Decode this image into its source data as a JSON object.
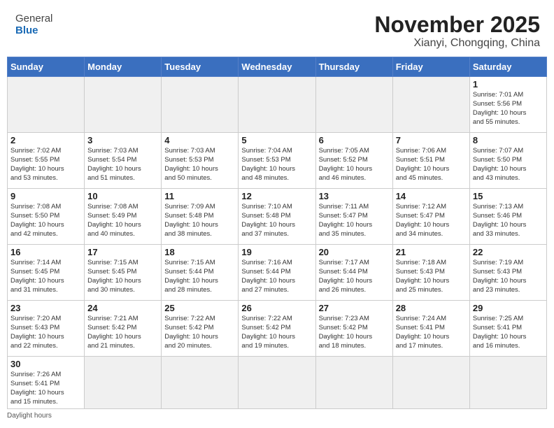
{
  "header": {
    "logo_general": "General",
    "logo_blue": "Blue",
    "month": "November 2025",
    "location": "Xianyi, Chongqing, China"
  },
  "weekdays": [
    "Sunday",
    "Monday",
    "Tuesday",
    "Wednesday",
    "Thursday",
    "Friday",
    "Saturday"
  ],
  "weeks": [
    [
      {
        "day": "",
        "info": ""
      },
      {
        "day": "",
        "info": ""
      },
      {
        "day": "",
        "info": ""
      },
      {
        "day": "",
        "info": ""
      },
      {
        "day": "",
        "info": ""
      },
      {
        "day": "",
        "info": ""
      },
      {
        "day": "1",
        "info": "Sunrise: 7:01 AM\nSunset: 5:56 PM\nDaylight: 10 hours\nand 55 minutes."
      }
    ],
    [
      {
        "day": "2",
        "info": "Sunrise: 7:02 AM\nSunset: 5:55 PM\nDaylight: 10 hours\nand 53 minutes."
      },
      {
        "day": "3",
        "info": "Sunrise: 7:03 AM\nSunset: 5:54 PM\nDaylight: 10 hours\nand 51 minutes."
      },
      {
        "day": "4",
        "info": "Sunrise: 7:03 AM\nSunset: 5:53 PM\nDaylight: 10 hours\nand 50 minutes."
      },
      {
        "day": "5",
        "info": "Sunrise: 7:04 AM\nSunset: 5:53 PM\nDaylight: 10 hours\nand 48 minutes."
      },
      {
        "day": "6",
        "info": "Sunrise: 7:05 AM\nSunset: 5:52 PM\nDaylight: 10 hours\nand 46 minutes."
      },
      {
        "day": "7",
        "info": "Sunrise: 7:06 AM\nSunset: 5:51 PM\nDaylight: 10 hours\nand 45 minutes."
      },
      {
        "day": "8",
        "info": "Sunrise: 7:07 AM\nSunset: 5:50 PM\nDaylight: 10 hours\nand 43 minutes."
      }
    ],
    [
      {
        "day": "9",
        "info": "Sunrise: 7:08 AM\nSunset: 5:50 PM\nDaylight: 10 hours\nand 42 minutes."
      },
      {
        "day": "10",
        "info": "Sunrise: 7:08 AM\nSunset: 5:49 PM\nDaylight: 10 hours\nand 40 minutes."
      },
      {
        "day": "11",
        "info": "Sunrise: 7:09 AM\nSunset: 5:48 PM\nDaylight: 10 hours\nand 38 minutes."
      },
      {
        "day": "12",
        "info": "Sunrise: 7:10 AM\nSunset: 5:48 PM\nDaylight: 10 hours\nand 37 minutes."
      },
      {
        "day": "13",
        "info": "Sunrise: 7:11 AM\nSunset: 5:47 PM\nDaylight: 10 hours\nand 35 minutes."
      },
      {
        "day": "14",
        "info": "Sunrise: 7:12 AM\nSunset: 5:47 PM\nDaylight: 10 hours\nand 34 minutes."
      },
      {
        "day": "15",
        "info": "Sunrise: 7:13 AM\nSunset: 5:46 PM\nDaylight: 10 hours\nand 33 minutes."
      }
    ],
    [
      {
        "day": "16",
        "info": "Sunrise: 7:14 AM\nSunset: 5:45 PM\nDaylight: 10 hours\nand 31 minutes."
      },
      {
        "day": "17",
        "info": "Sunrise: 7:15 AM\nSunset: 5:45 PM\nDaylight: 10 hours\nand 30 minutes."
      },
      {
        "day": "18",
        "info": "Sunrise: 7:15 AM\nSunset: 5:44 PM\nDaylight: 10 hours\nand 28 minutes."
      },
      {
        "day": "19",
        "info": "Sunrise: 7:16 AM\nSunset: 5:44 PM\nDaylight: 10 hours\nand 27 minutes."
      },
      {
        "day": "20",
        "info": "Sunrise: 7:17 AM\nSunset: 5:44 PM\nDaylight: 10 hours\nand 26 minutes."
      },
      {
        "day": "21",
        "info": "Sunrise: 7:18 AM\nSunset: 5:43 PM\nDaylight: 10 hours\nand 25 minutes."
      },
      {
        "day": "22",
        "info": "Sunrise: 7:19 AM\nSunset: 5:43 PM\nDaylight: 10 hours\nand 23 minutes."
      }
    ],
    [
      {
        "day": "23",
        "info": "Sunrise: 7:20 AM\nSunset: 5:43 PM\nDaylight: 10 hours\nand 22 minutes."
      },
      {
        "day": "24",
        "info": "Sunrise: 7:21 AM\nSunset: 5:42 PM\nDaylight: 10 hours\nand 21 minutes."
      },
      {
        "day": "25",
        "info": "Sunrise: 7:22 AM\nSunset: 5:42 PM\nDaylight: 10 hours\nand 20 minutes."
      },
      {
        "day": "26",
        "info": "Sunrise: 7:22 AM\nSunset: 5:42 PM\nDaylight: 10 hours\nand 19 minutes."
      },
      {
        "day": "27",
        "info": "Sunrise: 7:23 AM\nSunset: 5:42 PM\nDaylight: 10 hours\nand 18 minutes."
      },
      {
        "day": "28",
        "info": "Sunrise: 7:24 AM\nSunset: 5:41 PM\nDaylight: 10 hours\nand 17 minutes."
      },
      {
        "day": "29",
        "info": "Sunrise: 7:25 AM\nSunset: 5:41 PM\nDaylight: 10 hours\nand 16 minutes."
      }
    ],
    [
      {
        "day": "30",
        "info": "Sunrise: 7:26 AM\nSunset: 5:41 PM\nDaylight: 10 hours\nand 15 minutes."
      },
      {
        "day": "",
        "info": ""
      },
      {
        "day": "",
        "info": ""
      },
      {
        "day": "",
        "info": ""
      },
      {
        "day": "",
        "info": ""
      },
      {
        "day": "",
        "info": ""
      },
      {
        "day": "",
        "info": ""
      }
    ]
  ],
  "footer": {
    "daylight_label": "Daylight hours"
  }
}
